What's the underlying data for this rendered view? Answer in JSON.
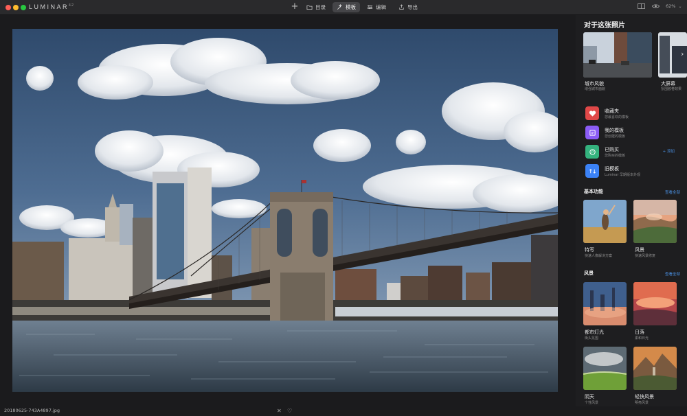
{
  "app": {
    "logo": "LUMINAR",
    "version": "4.2"
  },
  "toolbar": {
    "add_label": "+",
    "tabs": [
      {
        "label": "目录",
        "icon": "folder-icon"
      },
      {
        "label": "模板",
        "icon": "template-wand-icon",
        "active": true
      },
      {
        "label": "编辑",
        "icon": "sliders-icon"
      },
      {
        "label": "导出",
        "icon": "export-icon"
      }
    ],
    "zoom": "62%"
  },
  "panel": {
    "title": "对于这张照片",
    "featured": [
      {
        "name": "城市风貌",
        "sub": "增强城市面貌"
      },
      {
        "name": "大屏幕",
        "sub": "氛围胶卷效果"
      }
    ],
    "categories": [
      {
        "title": "收藏夹",
        "sub": "您最喜欢的模板",
        "color": "#e04848"
      },
      {
        "title": "我的模板",
        "sub": "您创建的模板",
        "color": "#8b5cf6"
      },
      {
        "title": "已购买",
        "sub": "您购买的模板",
        "color": "#34b37e",
        "action": "+ 添加"
      },
      {
        "title": "旧模板",
        "sub": "Luminar 早期版本外观",
        "color": "#3b82f6"
      }
    ],
    "sections": [
      {
        "title": "基本功能",
        "link": "查看全部",
        "items": [
          {
            "name": "特写",
            "sub": "快速人像解决方案"
          },
          {
            "name": "风景",
            "sub": "快速风景修复"
          }
        ]
      },
      {
        "title": "风景",
        "link": "查看全部",
        "items": [
          {
            "name": "都市灯光",
            "sub": "街头氛围"
          },
          {
            "name": "日落",
            "sub": "柔和日光"
          },
          {
            "name": "阴天",
            "sub": "个性风景"
          },
          {
            "name": "轻快风景",
            "sub": "明亮风景"
          }
        ]
      }
    ]
  },
  "status": {
    "filename": "20180625-743A4897.jpg"
  },
  "colors": {
    "accent": "#4a90e2",
    "background": "#1e1e20",
    "titlebar": "#2a2a2c"
  }
}
